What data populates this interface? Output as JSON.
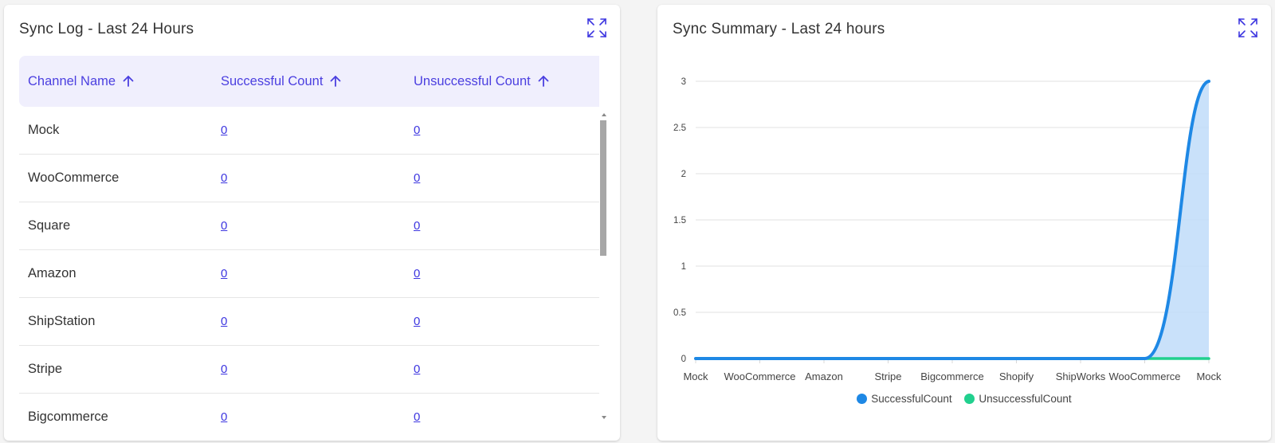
{
  "sync_log": {
    "title": "Sync Log - Last 24 Hours",
    "expand_icon": "expand-icon",
    "columns": [
      "Channel Name",
      "Successful Count",
      "Unsuccessful Count"
    ],
    "rows": [
      {
        "channel": "Mock",
        "successful": "0",
        "unsuccessful": "0"
      },
      {
        "channel": "WooCommerce",
        "successful": "0",
        "unsuccessful": "0"
      },
      {
        "channel": "Square",
        "successful": "0",
        "unsuccessful": "0"
      },
      {
        "channel": "Amazon",
        "successful": "0",
        "unsuccessful": "0"
      },
      {
        "channel": "ShipStation",
        "successful": "0",
        "unsuccessful": "0"
      },
      {
        "channel": "Stripe",
        "successful": "0",
        "unsuccessful": "0"
      },
      {
        "channel": "Bigcommerce",
        "successful": "0",
        "unsuccessful": "0"
      }
    ]
  },
  "sync_summary": {
    "title": "Sync Summary - Last 24 hours",
    "expand_icon": "expand-icon"
  },
  "colors": {
    "accent": "#4b3fe0",
    "header_bg": "#f0effd",
    "successful": "#1e88e5",
    "successful_fill": "#bfdcf9",
    "unsuccessful": "#21d08e"
  },
  "chart_data": {
    "type": "area",
    "title": "",
    "xlabel": "",
    "ylabel": "",
    "categories": [
      "Mock",
      "WooCommerce",
      "Amazon",
      "Stripe",
      "Bigcommerce",
      "Shopify",
      "ShipWorks",
      "WooCommerce",
      "Mock"
    ],
    "ylim": [
      0,
      3
    ],
    "yticks": [
      "0",
      "0.5",
      "1",
      "1.5",
      "2",
      "2.5",
      "3"
    ],
    "grid": true,
    "legend_position": "bottom",
    "series": [
      {
        "name": "SuccessfulCount",
        "values": [
          0,
          0,
          0,
          0,
          0,
          0,
          0,
          0,
          3
        ]
      },
      {
        "name": "UnsuccessfulCount",
        "values": [
          0,
          0,
          0,
          0,
          0,
          0,
          0,
          0,
          0
        ]
      }
    ]
  }
}
